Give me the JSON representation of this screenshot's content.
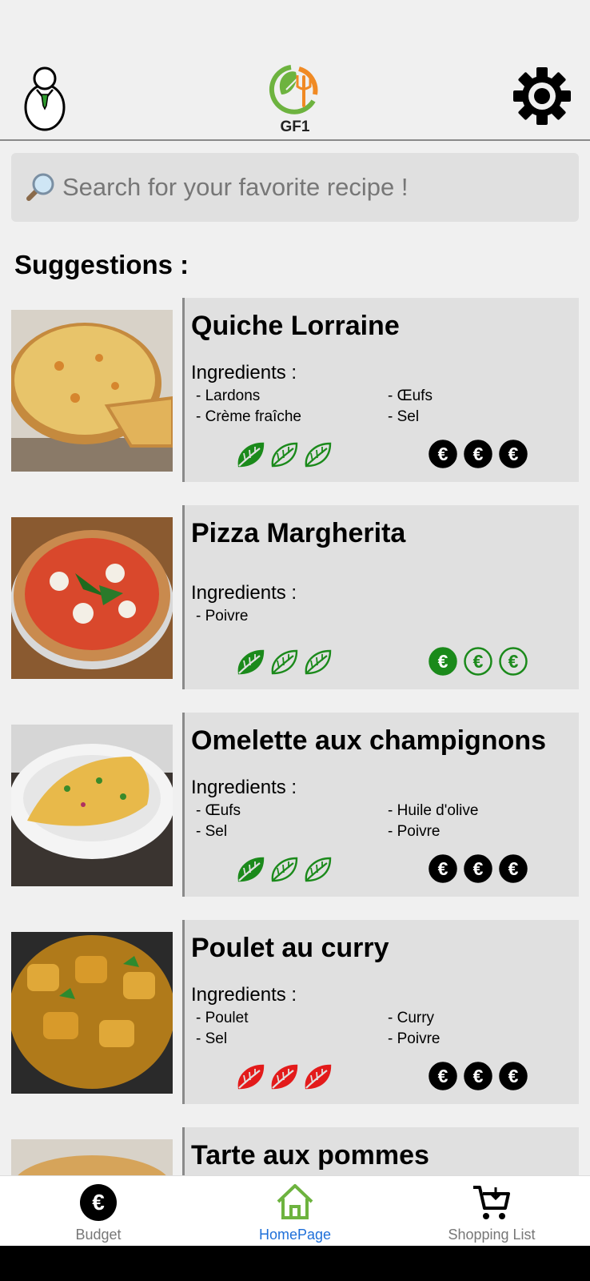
{
  "app": {
    "logo_text": "GF1"
  },
  "search": {
    "placeholder": "Search for your favorite recipe !"
  },
  "section": {
    "title": "Suggestions :"
  },
  "ingredients_label": "Ingredients :",
  "colors": {
    "eco_green": "#1b8a1b",
    "eco_red": "#e31b1b",
    "price_black": "#000000",
    "price_green": "#1b8a1b",
    "nav_active": "#1e6fd9",
    "logo_green": "#6db33f",
    "logo_orange": "#f08a24"
  },
  "recipes": [
    {
      "name": "Quiche Lorraine",
      "ingredients": [
        "- Lardons",
        "- Crème fraîche",
        "- Œufs",
        "- Sel"
      ],
      "eco_filled": 1,
      "eco_color": "green",
      "price_filled": 3,
      "price_color": "black",
      "photo": "quiche"
    },
    {
      "name": "Pizza Margherita",
      "ingredients": [
        "- Poivre"
      ],
      "eco_filled": 1,
      "eco_color": "green",
      "price_filled": 1,
      "price_color": "green",
      "photo": "pizza"
    },
    {
      "name": "Omelette aux champignons",
      "ingredients": [
        "- Œufs",
        "- Sel",
        "- Huile d'olive",
        "- Poivre"
      ],
      "eco_filled": 1,
      "eco_color": "green",
      "price_filled": 3,
      "price_color": "black",
      "photo": "omelette"
    },
    {
      "name": "Poulet au curry",
      "ingredients": [
        "- Poulet",
        "- Sel",
        "- Curry",
        "- Poivre"
      ],
      "eco_filled": 3,
      "eco_color": "red",
      "price_filled": 3,
      "price_color": "black",
      "photo": "curry"
    },
    {
      "name": "Tarte aux pommes",
      "ingredients": [],
      "eco_filled": 0,
      "eco_color": "green",
      "price_filled": 0,
      "price_color": "black",
      "photo": "tarte"
    }
  ],
  "nav": [
    {
      "label": "Budget",
      "icon": "euro-circle-icon",
      "active": false
    },
    {
      "label": "HomePage",
      "icon": "home-icon",
      "active": true
    },
    {
      "label": "Shopping List",
      "icon": "cart-icon",
      "active": false
    }
  ]
}
